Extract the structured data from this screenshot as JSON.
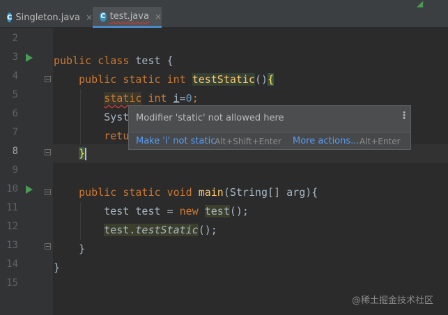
{
  "tabs": [
    {
      "label": "Singleton.java",
      "icon": "class-c-icon",
      "icon_glyph": "C",
      "close": "×",
      "active": false
    },
    {
      "label": "test.java",
      "icon": "class-c-icon",
      "icon_glyph": "C",
      "close": "×",
      "active": true
    }
  ],
  "corner_glyph": "◢",
  "line_numbers": [
    "2",
    "3",
    "4",
    "5",
    "6",
    "7",
    "8",
    "9",
    "10",
    "11",
    "12",
    "13",
    "14",
    "15"
  ],
  "code": {
    "l3": {
      "kw1": "public",
      "kw2": "class",
      "name": "test",
      "brace": "{"
    },
    "l4": {
      "kw1": "public",
      "kw2": "static",
      "kw3": "int",
      "method": "testStatic",
      "parens": "()",
      "brace": "{"
    },
    "l5": {
      "kw1": "static",
      "kw2": "int",
      "var": "i",
      "eq": "=",
      "num": "0",
      "semi": ";"
    },
    "l6": {
      "text": "Syst"
    },
    "l7": {
      "kw": "retu"
    },
    "l8": {
      "brace": "}"
    },
    "l10": {
      "kw1": "public",
      "kw2": "static",
      "kw3": "void",
      "method": "main",
      "params": "(String[] arg)",
      "brace": "{"
    },
    "l11": {
      "type": "test",
      "var": "test",
      "eq": "=",
      "kw": "new",
      "ctor": "test",
      "tail": "();"
    },
    "l12": {
      "obj": "test.",
      "method": "testStatic",
      "tail": "();"
    },
    "l13": {
      "brace": "}"
    },
    "l14": {
      "brace": "}"
    }
  },
  "popup": {
    "message": "Modifier 'static' not allowed here",
    "more_glyph": "⋮",
    "action1": "Make 'i' not static",
    "shortcut1": "Alt+Shift+Enter",
    "action2": "More actions...",
    "shortcut2": "Alt+Enter"
  },
  "watermark": "@稀土掘金技术社区",
  "colors": {
    "background": "#2b2b2b",
    "keyword": "#cc7832",
    "method": "#ffc66d",
    "number": "#6897bb",
    "error_underline": "#bc3f3c",
    "link": "#589df6",
    "run": "#499c54"
  }
}
